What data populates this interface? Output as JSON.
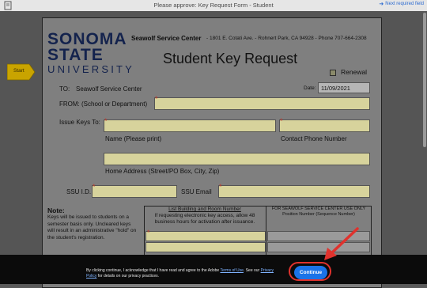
{
  "header": {
    "title": "Please approve: Key Request Form - Student",
    "next_link": "Next required field"
  },
  "form": {
    "logo": {
      "line1": "SONOMA",
      "line2": "STATE",
      "line3": "UNIVERSITY"
    },
    "center_name": "Seawolf Service Center",
    "center_address": "- 1801 E. Cotati Ave. - Rohnert Park, CA 94928 - Phone 707-664-2308",
    "title": "Student Key Request",
    "renewal_label": "Renewal",
    "start_tag": "Start",
    "to_label": "TO:",
    "to_value": "Seawolf Service Center",
    "date_label": "Date:",
    "date_value": "11/09/2021",
    "from_label": "FROM: (School or Department)",
    "issue_keys_label": "Issue Keys To:",
    "name_caption": "Name (Please print)",
    "phone_caption": "Contact Phone Number",
    "address_caption": "Home Address (Street/PO Box, City, Zip)",
    "ssu_id_label": "SSU I.D.",
    "ssu_email_label": "SSU Email",
    "required_marker": "*",
    "note_title": "Note:",
    "note_body": "Keys will be issued to students on a semester basis only. Uncleared keys will result in an administrative \"hold\" on the student's registration.",
    "table": {
      "left_header_title": "List Building and Room Number",
      "left_header_sub": "If requesting electronic key access, allow 48 business hours for activation after issuance.",
      "right_header_title": "FOR SEAWOLF SERVICE CENTER USE ONLY",
      "right_header_sub": "Position Number (Sequence Number)"
    }
  },
  "consent": {
    "text_before": "By clicking continue, I acknowledge that I have read and agree to the Adobe ",
    "terms_link": "Terms of Use",
    "text_mid": ". See our ",
    "privacy_link": "Privacy Policy",
    "text_after": " for details on our privacy practices.",
    "continue_label": "Continue"
  },
  "colors": {
    "field_fill": "#d7d39c",
    "continue_button": "#1a73e8",
    "highlight": "#e0322d",
    "next_link": "#2c6bd1"
  }
}
